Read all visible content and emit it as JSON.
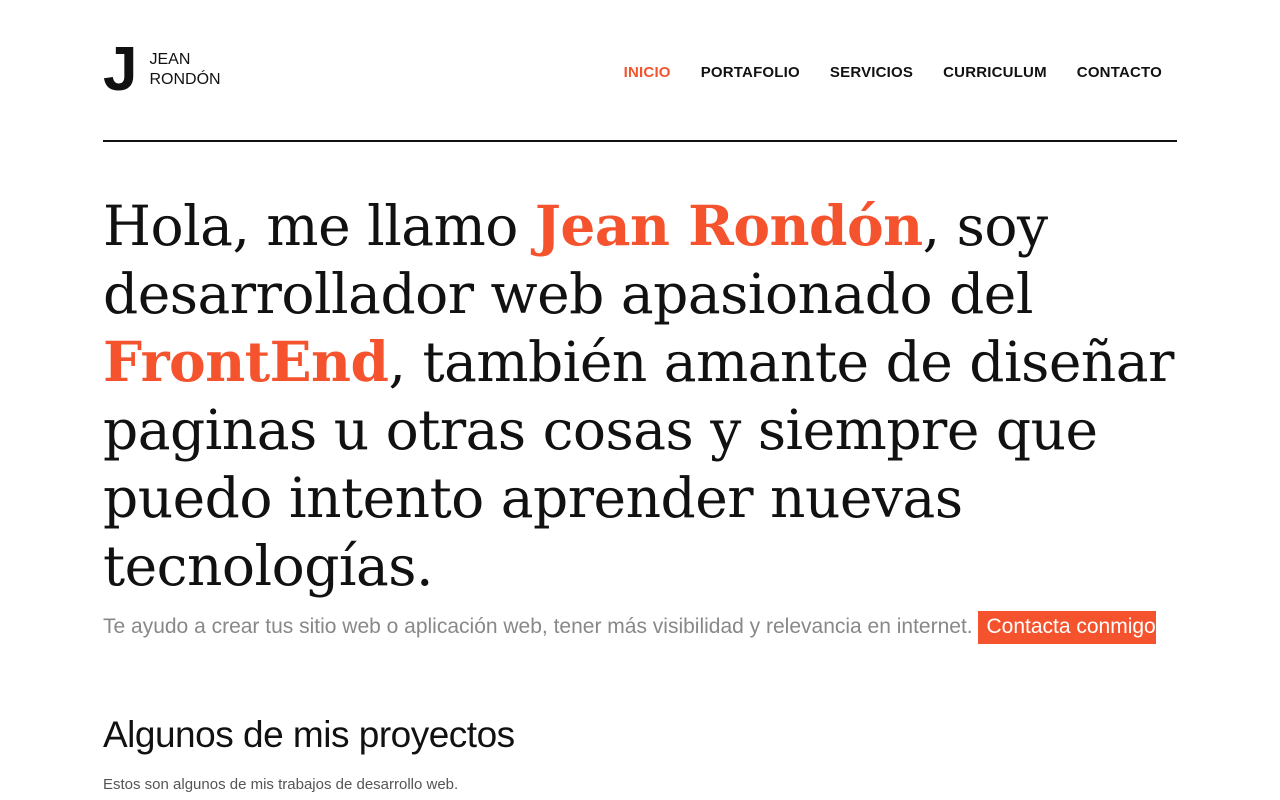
{
  "brand": {
    "letter": "J",
    "first_name": "JEAN",
    "last_name": "RONDÓN"
  },
  "nav": {
    "items": [
      {
        "label": "INICIO",
        "active": true
      },
      {
        "label": "PORTAFOLIO",
        "active": false
      },
      {
        "label": "SERVICIOS",
        "active": false
      },
      {
        "label": "CURRICULUM",
        "active": false
      },
      {
        "label": "CONTACTO",
        "active": false
      }
    ]
  },
  "hero": {
    "part1": "Hola, me llamo ",
    "name": "Jean Rondón",
    "part2": ", soy desarrollador web apasionado del ",
    "highlight": "FrontEnd",
    "part3": ", también amante de diseñar paginas u otras cosas y siempre que puedo intento aprender nuevas tecnologías."
  },
  "intro": {
    "text": "Te ayudo a crear tus sitio web o aplicación web, tener más visibilidad y relevancia en internet. ",
    "cta_label": "Contacta conmigo"
  },
  "projects": {
    "title": "Algunos de mis proyectos",
    "subtitle": "Estos son algunos de mis trabajos de desarrollo web."
  },
  "colors": {
    "accent": "#f4532e",
    "text": "#111111",
    "muted": "#888888"
  }
}
